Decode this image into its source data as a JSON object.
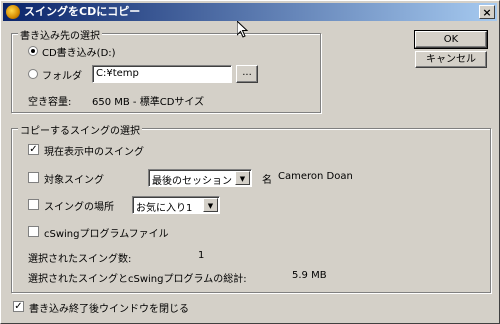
{
  "window": {
    "title": "スイングをCDにコピー"
  },
  "dest_group": {
    "legend": "書き込み先の選択",
    "options": [
      {
        "label": "CD書き込み(D:)",
        "selected": true
      },
      {
        "label": "フォルダ",
        "selected": false
      }
    ],
    "folder_path": "C:¥temp",
    "browse_label": "...",
    "free_space_label": "空き容量:",
    "free_space_value": "650 MB - 標準CDサイズ"
  },
  "buttons": {
    "ok": "OK",
    "cancel": "キャンセル"
  },
  "swing_group": {
    "legend": "コピーするスイングの選択",
    "current_swing": {
      "label": "現在表示中のスイング",
      "checked": true
    },
    "target_swing": {
      "label": "対象スイング",
      "checked": false,
      "select_value": "最後のセッション"
    },
    "name_label": "名",
    "name_value": "Cameron Doan",
    "swing_location": {
      "label": "スイングの場所",
      "checked": false,
      "select_value": "お気に入り1"
    },
    "program_file": {
      "label": "cSwingプログラムファイル",
      "checked": false
    },
    "selected_count_label": "選択されたスイング数:",
    "selected_count_value": "1",
    "total_label": "選択されたスイングとcSwingプログラムの総計:",
    "total_value": "5.9 MB"
  },
  "close_after": {
    "label": "書き込み終了後ウインドウを閉じる",
    "checked": true
  }
}
